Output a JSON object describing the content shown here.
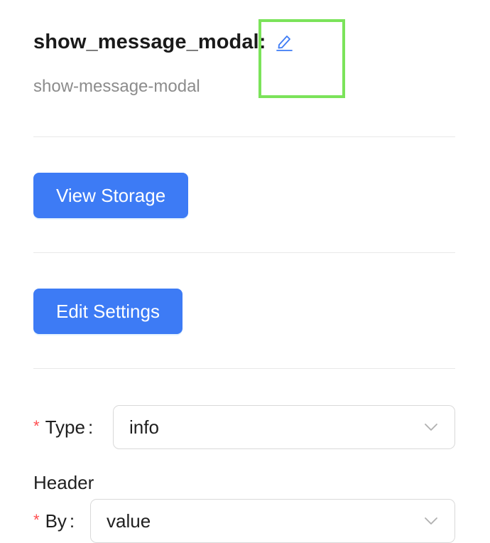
{
  "header": {
    "title": "show_message_modal:",
    "subtitle": "show-message-modal",
    "edit_icon": "pencil-edit-icon"
  },
  "actions": {
    "view_storage_label": "View Storage",
    "edit_settings_label": "Edit Settings"
  },
  "form": {
    "type": {
      "required_mark": "*",
      "label": "Type",
      "colon": ":",
      "value": "info"
    },
    "header_section_label": "Header",
    "by": {
      "required_mark": "*",
      "label": "By",
      "colon": ":",
      "value": "value"
    },
    "chevron_icon": "chevron-down-icon"
  },
  "colors": {
    "primary": "#3d7bf5",
    "required": "#ff4d4f",
    "highlight": "#7be35a",
    "muted_text": "#8c8c8c",
    "link_icon": "#3d7bf5"
  }
}
